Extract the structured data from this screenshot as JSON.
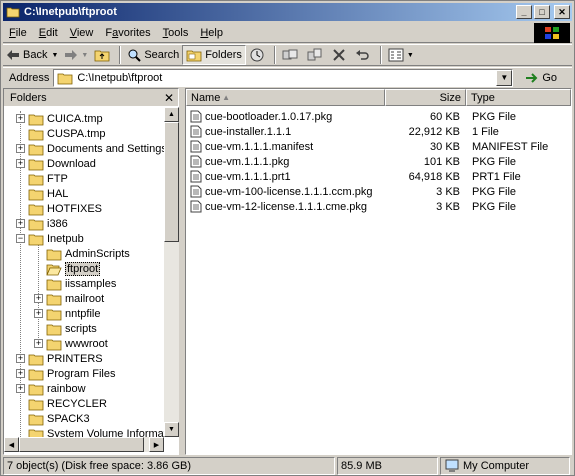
{
  "window": {
    "title": "C:\\Inetpub\\ftproot"
  },
  "menu": [
    "File",
    "Edit",
    "View",
    "Favorites",
    "Tools",
    "Help"
  ],
  "menu_underline": [
    "F",
    "E",
    "V",
    "a",
    "T",
    "H"
  ],
  "toolbar": {
    "back": "Back",
    "search": "Search",
    "folders": "Folders"
  },
  "address": {
    "label": "Address",
    "value": "C:\\Inetpub\\ftproot",
    "go": "Go"
  },
  "folders_pane": {
    "title": "Folders",
    "items": [
      {
        "label": "CUICA.tmp",
        "level": 0,
        "expander": "+"
      },
      {
        "label": "CUSPA.tmp",
        "level": 0,
        "expander": ""
      },
      {
        "label": "Documents and Settings",
        "level": 0,
        "expander": "+"
      },
      {
        "label": "Download",
        "level": 0,
        "expander": "+"
      },
      {
        "label": "FTP",
        "level": 0,
        "expander": ""
      },
      {
        "label": "HAL",
        "level": 0,
        "expander": ""
      },
      {
        "label": "HOTFIXES",
        "level": 0,
        "expander": ""
      },
      {
        "label": "i386",
        "level": 0,
        "expander": "+"
      },
      {
        "label": "Inetpub",
        "level": 0,
        "expander": "-"
      },
      {
        "label": "AdminScripts",
        "level": 1,
        "expander": ""
      },
      {
        "label": "ftproot",
        "level": 1,
        "expander": "",
        "selected": true
      },
      {
        "label": "iissamples",
        "level": 1,
        "expander": ""
      },
      {
        "label": "mailroot",
        "level": 1,
        "expander": "+"
      },
      {
        "label": "nntpfile",
        "level": 1,
        "expander": "+"
      },
      {
        "label": "scripts",
        "level": 1,
        "expander": ""
      },
      {
        "label": "wwwroot",
        "level": 1,
        "expander": "+"
      },
      {
        "label": "PRINTERS",
        "level": 0,
        "expander": "+"
      },
      {
        "label": "Program Files",
        "level": 0,
        "expander": "+"
      },
      {
        "label": "rainbow",
        "level": 0,
        "expander": "+"
      },
      {
        "label": "RECYCLER",
        "level": 0,
        "expander": ""
      },
      {
        "label": "SPACK3",
        "level": 0,
        "expander": ""
      },
      {
        "label": "System Volume Information",
        "level": 0,
        "expander": ""
      }
    ]
  },
  "file_list": {
    "columns": [
      "Name",
      "Size",
      "Type"
    ],
    "rows": [
      {
        "name": "cue-bootloader.1.0.17.pkg",
        "size": "60 KB",
        "type": "PKG File"
      },
      {
        "name": "cue-installer.1.1.1",
        "size": "22,912 KB",
        "type": "1 File"
      },
      {
        "name": "cue-vm.1.1.1.manifest",
        "size": "30 KB",
        "type": "MANIFEST File"
      },
      {
        "name": "cue-vm.1.1.1.pkg",
        "size": "101 KB",
        "type": "PKG File"
      },
      {
        "name": "cue-vm.1.1.1.prt1",
        "size": "64,918 KB",
        "type": "PRT1 File"
      },
      {
        "name": "cue-vm-100-license.1.1.1.ccm.pkg",
        "size": "3 KB",
        "type": "PKG File"
      },
      {
        "name": "cue-vm-12-license.1.1.1.cme.pkg",
        "size": "3 KB",
        "type": "PKG File"
      }
    ]
  },
  "status": {
    "objects": "7 object(s) (Disk free space: 3.86 GB)",
    "size": "85.9 MB",
    "zone": "My Computer"
  },
  "colors": {
    "titlebar_start": "#0a246a",
    "titlebar_end": "#a6caf0",
    "folder": "#f4d470"
  }
}
